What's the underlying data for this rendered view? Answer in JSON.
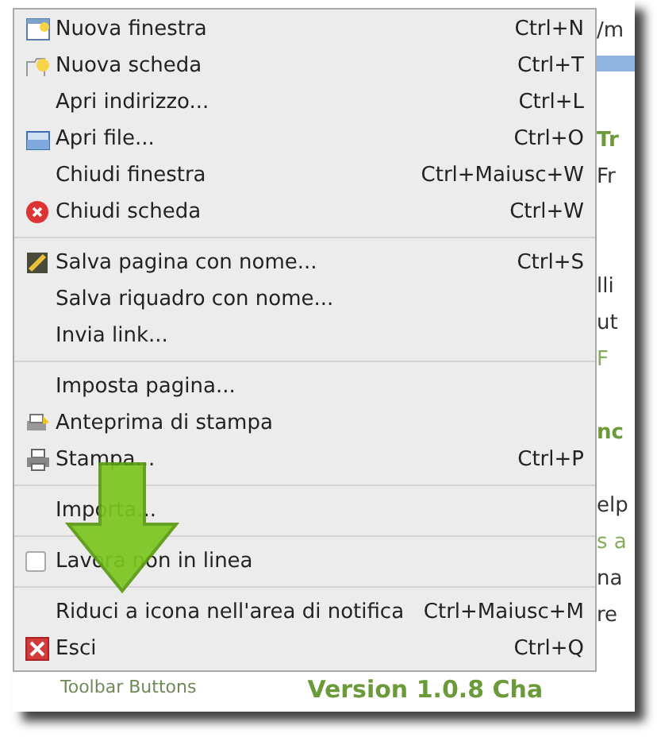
{
  "menu": {
    "items": [
      {
        "kind": "item",
        "label": "Nuova finestra",
        "shortcut": "Ctrl+N"
      },
      {
        "kind": "item",
        "label": "Nuova scheda",
        "shortcut": "Ctrl+T"
      },
      {
        "kind": "item",
        "label": "Apri indirizzo...",
        "shortcut": "Ctrl+L"
      },
      {
        "kind": "item",
        "label": "Apri file...",
        "shortcut": "Ctrl+O"
      },
      {
        "kind": "item",
        "label": "Chiudi finestra",
        "shortcut": "Ctrl+Maiusc+W"
      },
      {
        "kind": "item",
        "label": "Chiudi scheda",
        "shortcut": "Ctrl+W"
      },
      {
        "kind": "separator"
      },
      {
        "kind": "item",
        "label": "Salva pagina con nome...",
        "shortcut": "Ctrl+S"
      },
      {
        "kind": "item",
        "label": "Salva riquadro con nome..."
      },
      {
        "kind": "item",
        "label": "Invia link..."
      },
      {
        "kind": "separator"
      },
      {
        "kind": "item",
        "label": "Imposta pagina..."
      },
      {
        "kind": "item",
        "label": "Anteprima di stampa"
      },
      {
        "kind": "item",
        "label": "Stampa...",
        "shortcut": "Ctrl+P"
      },
      {
        "kind": "separator"
      },
      {
        "kind": "item",
        "label": "Importa..."
      },
      {
        "kind": "separator"
      },
      {
        "kind": "checkbox",
        "label": "Lavora non in linea",
        "checked": false
      },
      {
        "kind": "separator"
      },
      {
        "kind": "item",
        "label": "Riduci a icona nell'area di notifica",
        "shortcut": "Ctrl+Maiusc+M"
      },
      {
        "kind": "item",
        "label": "Esci",
        "shortcut": "Ctrl+Q"
      }
    ]
  },
  "page": {
    "fragments": [
      {
        "kind": "text",
        "text": "/m"
      },
      {
        "kind": "tabbar"
      },
      {
        "kind": "gap"
      },
      {
        "kind": "heading",
        "text": "Tr"
      },
      {
        "kind": "text",
        "text": "Fr"
      },
      {
        "kind": "gap"
      },
      {
        "kind": "gap"
      },
      {
        "kind": "text",
        "text": "lli"
      },
      {
        "kind": "text",
        "text": "ut"
      },
      {
        "kind": "link",
        "text": "F"
      },
      {
        "kind": "gap"
      },
      {
        "kind": "heading",
        "text": "nc"
      },
      {
        "kind": "gap"
      },
      {
        "kind": "text",
        "text": "elp"
      },
      {
        "kind": "link",
        "text": "s a"
      },
      {
        "kind": "text",
        "text": "na"
      },
      {
        "kind": "text",
        "text": "re"
      }
    ],
    "sidebar_item": "Toolbar Buttons",
    "title": "Version 1.0.8 Cha"
  }
}
